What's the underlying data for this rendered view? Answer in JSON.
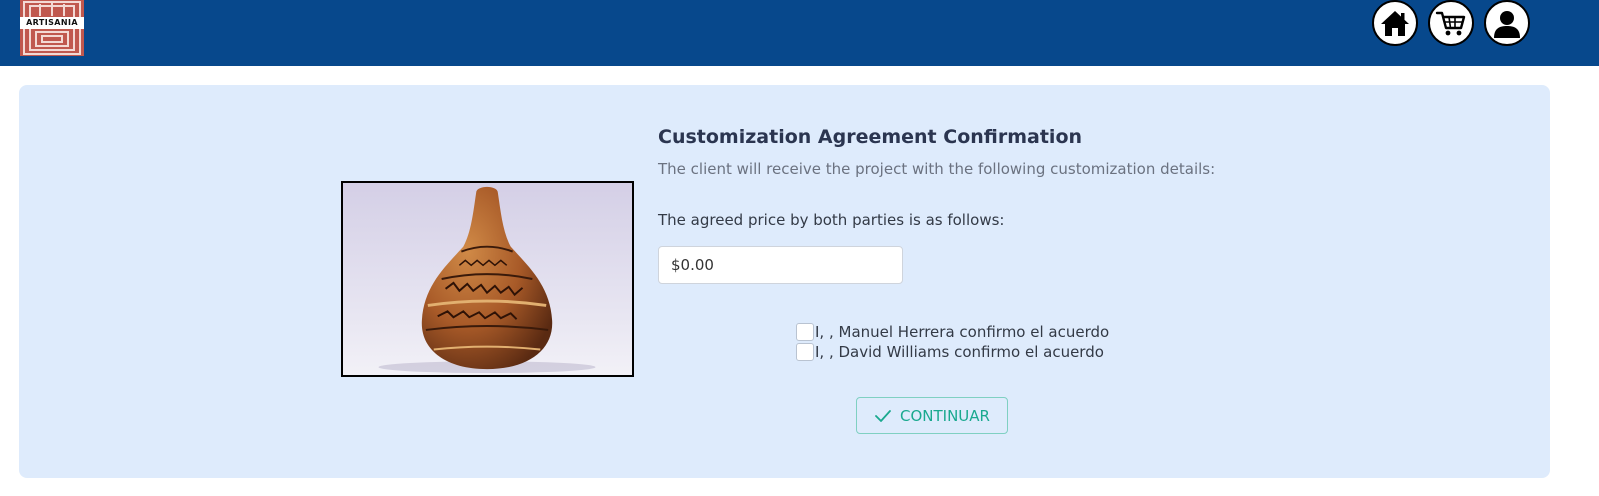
{
  "header": {
    "logo_text": "ARTISANIA",
    "icons": [
      "home-icon",
      "cart-icon",
      "user-icon"
    ],
    "background_color": "#07488c"
  },
  "main": {
    "title": "Customization Agreement Confirmation",
    "subtitle": "The client will receive the project with the following customization details:",
    "price_label": "The agreed price by both parties is as follows:",
    "price_value": "$0.00",
    "agreements": [
      {
        "label": "I, , Manuel Herrera confirmo el acuerdo",
        "checked": false
      },
      {
        "label": "I, , David Williams confirmo el acuerdo",
        "checked": false
      }
    ],
    "continue_label": "CONTINUAR",
    "card_color": "#deebfc",
    "accent_color": "#1aa98f"
  }
}
